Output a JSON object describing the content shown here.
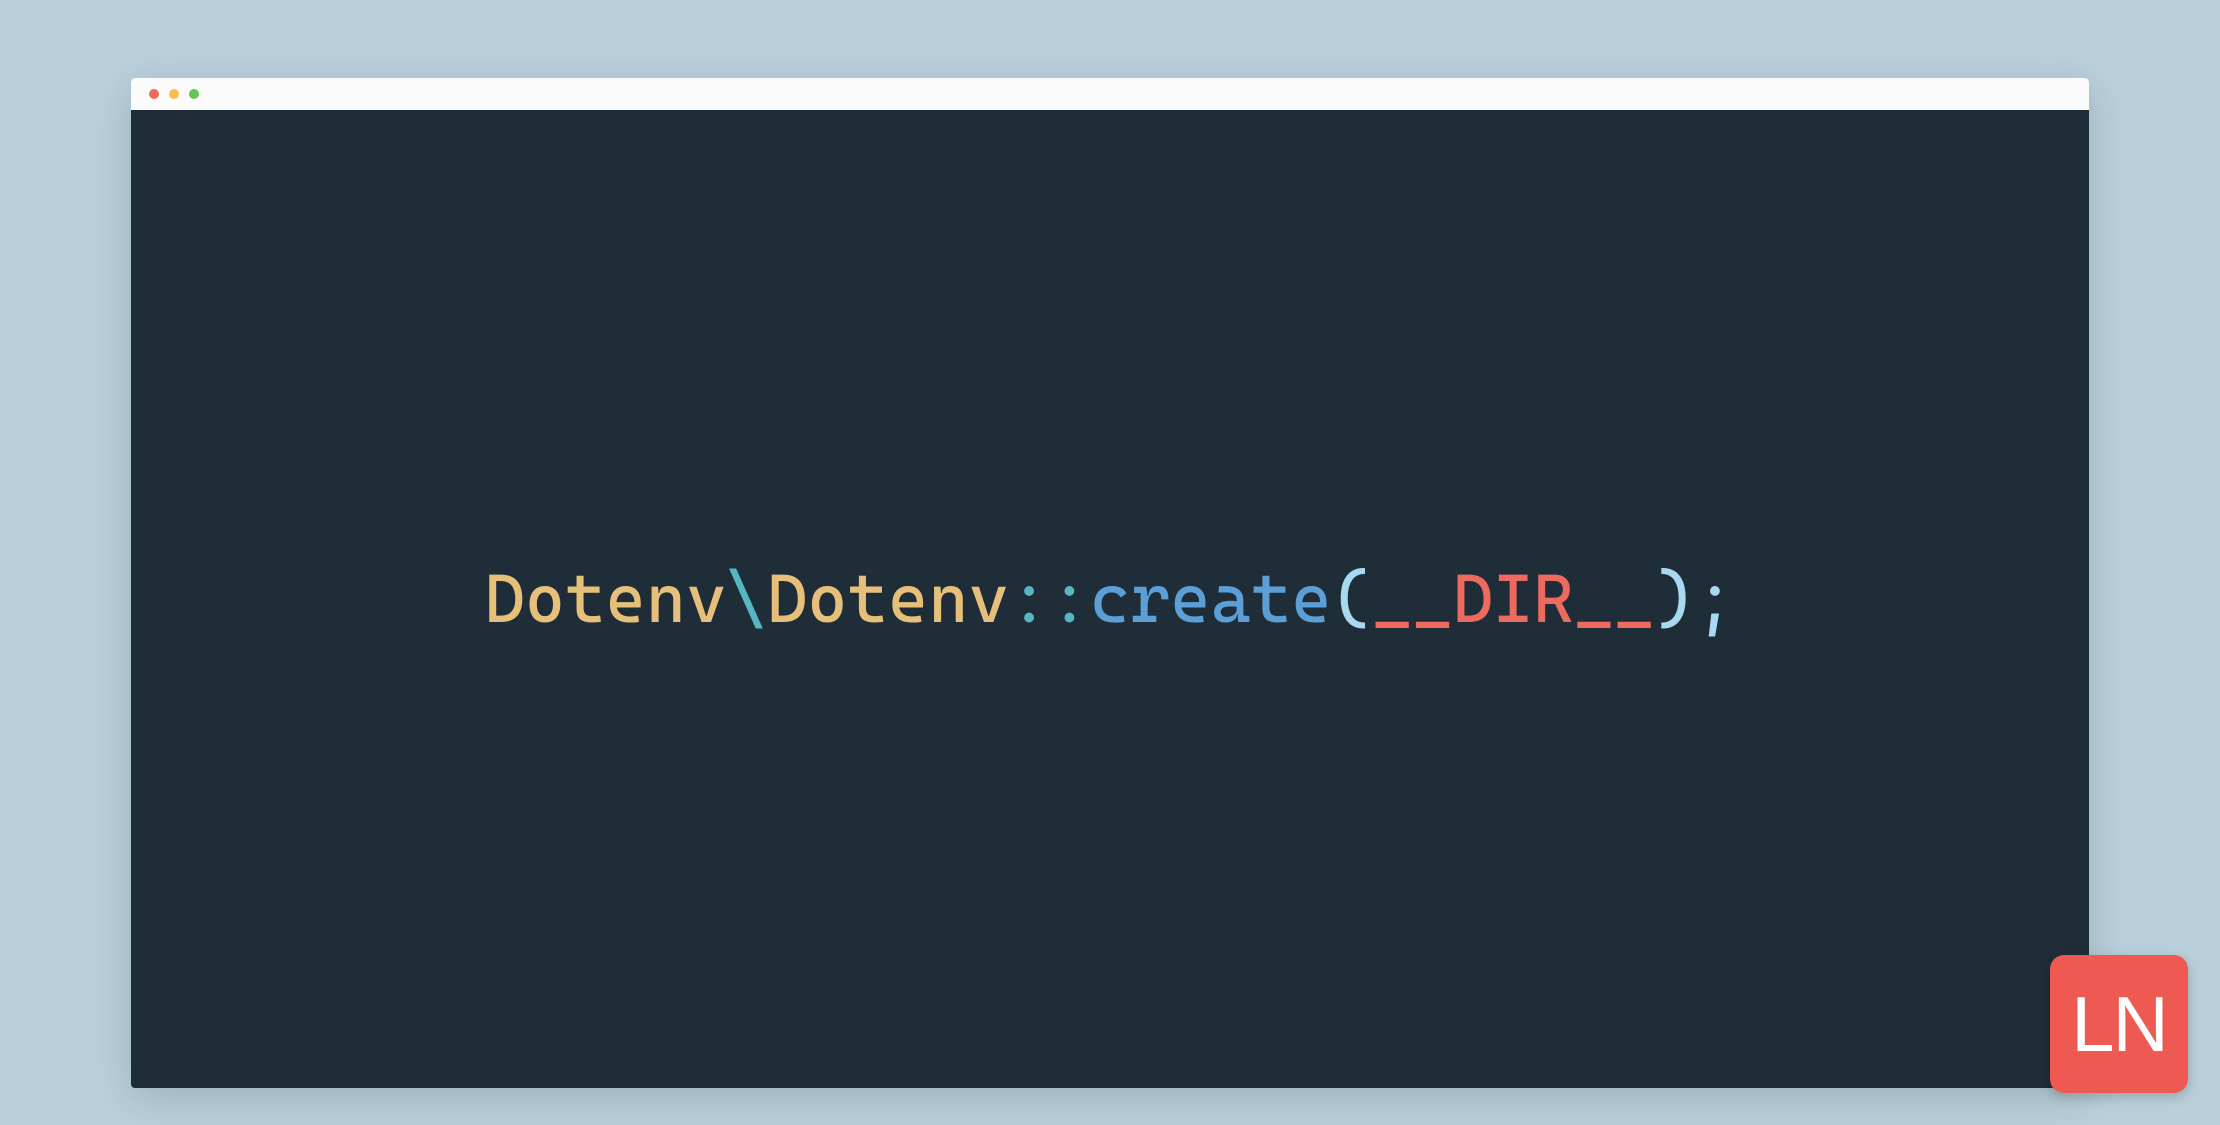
{
  "titlebar": {
    "traffic_lights": [
      "close",
      "minimize",
      "maximize"
    ]
  },
  "code": {
    "tokens": {
      "namespace": "Dotenv",
      "backslash": "\\",
      "class": "Dotenv",
      "scope": "::",
      "method": "create",
      "paren_open": "(",
      "constant": "__DIR__",
      "paren_close": ")",
      "semicolon": ";"
    }
  },
  "logo": {
    "text": "LN"
  },
  "colors": {
    "background": "#b9cfdb",
    "editor_bg": "#1f2d38",
    "titlebar_bg": "#fbfbfc",
    "class_token": "#e6c07b",
    "separator_token": "#56b6c2",
    "method_token": "#5c9fd6",
    "paren_token": "#a7d9ef",
    "constant_token": "#ed6a5e",
    "logo_bg": "#ee5a52",
    "logo_fg": "#ffffff"
  }
}
